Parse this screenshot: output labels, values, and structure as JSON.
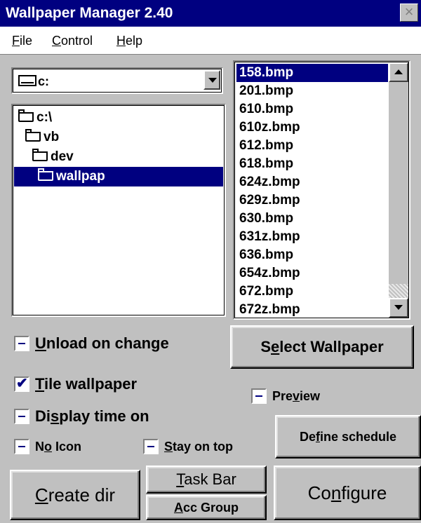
{
  "window": {
    "title": "Wallpaper Manager 2.40",
    "close_glyph": "×"
  },
  "menu": [
    {
      "pre": "",
      "accel": "F",
      "post": "ile"
    },
    {
      "pre": "",
      "accel": "C",
      "post": "ontrol"
    },
    {
      "pre": "",
      "accel": "H",
      "post": "elp"
    }
  ],
  "drive": {
    "value": "c:",
    "icon": "drive-icon"
  },
  "tree": [
    {
      "label": "c:\\",
      "icon": "folder-open-icon"
    },
    {
      "label": "vb",
      "icon": "folder-open-icon"
    },
    {
      "label": "dev",
      "icon": "folder-open-icon"
    },
    {
      "label": "wallpap",
      "icon": "folder-open-icon",
      "selected": true
    }
  ],
  "files": [
    "158.bmp",
    "201.bmp",
    "610.bmp",
    "610z.bmp",
    "612.bmp",
    "618.bmp",
    "624z.bmp",
    "629z.bmp",
    "630.bmp",
    "631z.bmp",
    "636.bmp",
    "654z.bmp",
    "672.bmp",
    "672z.bmp"
  ],
  "selected_file": "158.bmp",
  "checkboxes": {
    "unload": {
      "pre": "",
      "accel": "U",
      "post": "nload on change",
      "checked": false
    },
    "tile": {
      "pre": "",
      "accel": "T",
      "post": "ile wallpaper",
      "checked": true
    },
    "display_time": {
      "pre": "Di",
      "accel": "s",
      "post": "play time on",
      "checked": false
    },
    "no_icon": {
      "pre": "N",
      "accel": "o",
      "post": " Icon",
      "checked": false
    },
    "stay_on_top": {
      "pre": "",
      "accel": "S",
      "post": "tay on top",
      "checked": false
    },
    "preview": {
      "pre": "Pre",
      "accel": "v",
      "post": "iew",
      "checked": false
    }
  },
  "buttons": {
    "select_wallpaper": {
      "pre": "S",
      "accel": "e",
      "post": "lect Wallpaper"
    },
    "define_schedule": {
      "pre": "De",
      "accel": "f",
      "post": "ine schedule"
    },
    "create_dir": {
      "pre": "",
      "accel": "C",
      "post": "reate dir"
    },
    "task_bar": {
      "pre": "",
      "accel": "T",
      "post": "ask Bar"
    },
    "acc_group": {
      "pre": "",
      "accel": "A",
      "post": "cc Group"
    },
    "configure": {
      "pre": "Co",
      "accel": "n",
      "post": "figure"
    }
  },
  "colors": {
    "selection": "#000080",
    "face": "#c0c0c0"
  }
}
